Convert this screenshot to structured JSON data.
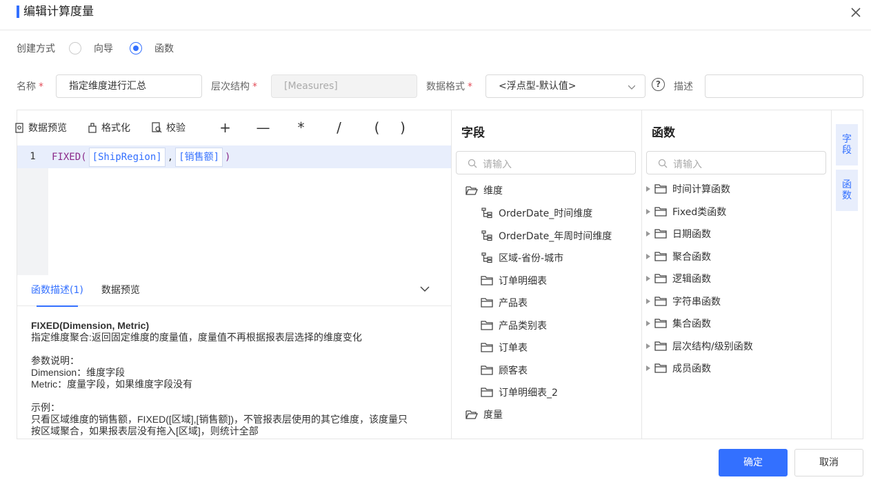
{
  "dialog": {
    "title": "编辑计算度量"
  },
  "create_mode": {
    "label": "创建方式",
    "options": [
      "向导",
      "函数"
    ],
    "selected": "函数"
  },
  "form": {
    "name_label": "名称",
    "name_value": "指定维度进行汇总",
    "hierarchy_label": "层次结构",
    "hierarchy_value": "[Measures]",
    "format_label": "数据格式",
    "format_value": "<浮点型-默认值>",
    "help_glyph": "?",
    "desc_label": "描述",
    "desc_value": "",
    "required_mark": "*"
  },
  "toolbar": {
    "preview": "数据预览",
    "format": "格式化",
    "validate": "校验",
    "operators": [
      "+",
      "—",
      "*",
      "/",
      "(",
      ")"
    ]
  },
  "editor": {
    "line_number": "1",
    "fn_open": "FIXED(",
    "token1": "[ShipRegion]",
    "comma": ",",
    "token2": "[销售额]",
    "fn_close": ")"
  },
  "bottom": {
    "tabs": [
      "函数描述(1)",
      "数据预览"
    ],
    "active_tab": "函数描述(1)",
    "desc_title": "FIXED(Dimension, Metric)",
    "desc_line1": "指定维度聚合:返回固定维度的度量值，度量值不再根据报表层选择的维度变化",
    "params_head": "参数说明：",
    "param1": "Dimension：维度字段",
    "param2": "Metric：度量字段，如果维度字段没有",
    "example_head": "示例：",
    "example1": "只看区域维度的销售额，FIXED([区域],[销售额])，不管报表层使用的其它维度，该度量只",
    "example2": "按区域聚合，如果报表层没有拖入[区域]，则统计全部"
  },
  "fields": {
    "title": "字段",
    "search_placeholder": "请输入",
    "dimension_group": "维度",
    "dimension_items": [
      {
        "label": "OrderDate_时间维度",
        "icon": "hierarchy-icon"
      },
      {
        "label": "OrderDate_年周时间维度",
        "icon": "hierarchy-icon"
      },
      {
        "label": "区域-省份-城市",
        "icon": "hierarchy-icon"
      },
      {
        "label": "订单明细表",
        "icon": "folder-icon"
      },
      {
        "label": "产品表",
        "icon": "folder-icon"
      },
      {
        "label": "产品类别表",
        "icon": "folder-icon"
      },
      {
        "label": "订单表",
        "icon": "folder-icon"
      },
      {
        "label": "顾客表",
        "icon": "folder-icon"
      },
      {
        "label": "订单明细表_2",
        "icon": "folder-icon"
      }
    ],
    "measure_group": "度量"
  },
  "functions": {
    "title": "函数",
    "search_placeholder": "请输入",
    "items": [
      "时间计算函数",
      "Fixed类函数",
      "日期函数",
      "聚合函数",
      "逻辑函数",
      "字符串函数",
      "集合函数",
      "层次结构/级别函数",
      "成员函数"
    ]
  },
  "side_tabs": [
    "字段",
    "函数"
  ],
  "buttons": {
    "ok": "确定",
    "cancel": "取消"
  },
  "colors": {
    "accent": "#3370ff",
    "required": "#e34d59"
  }
}
